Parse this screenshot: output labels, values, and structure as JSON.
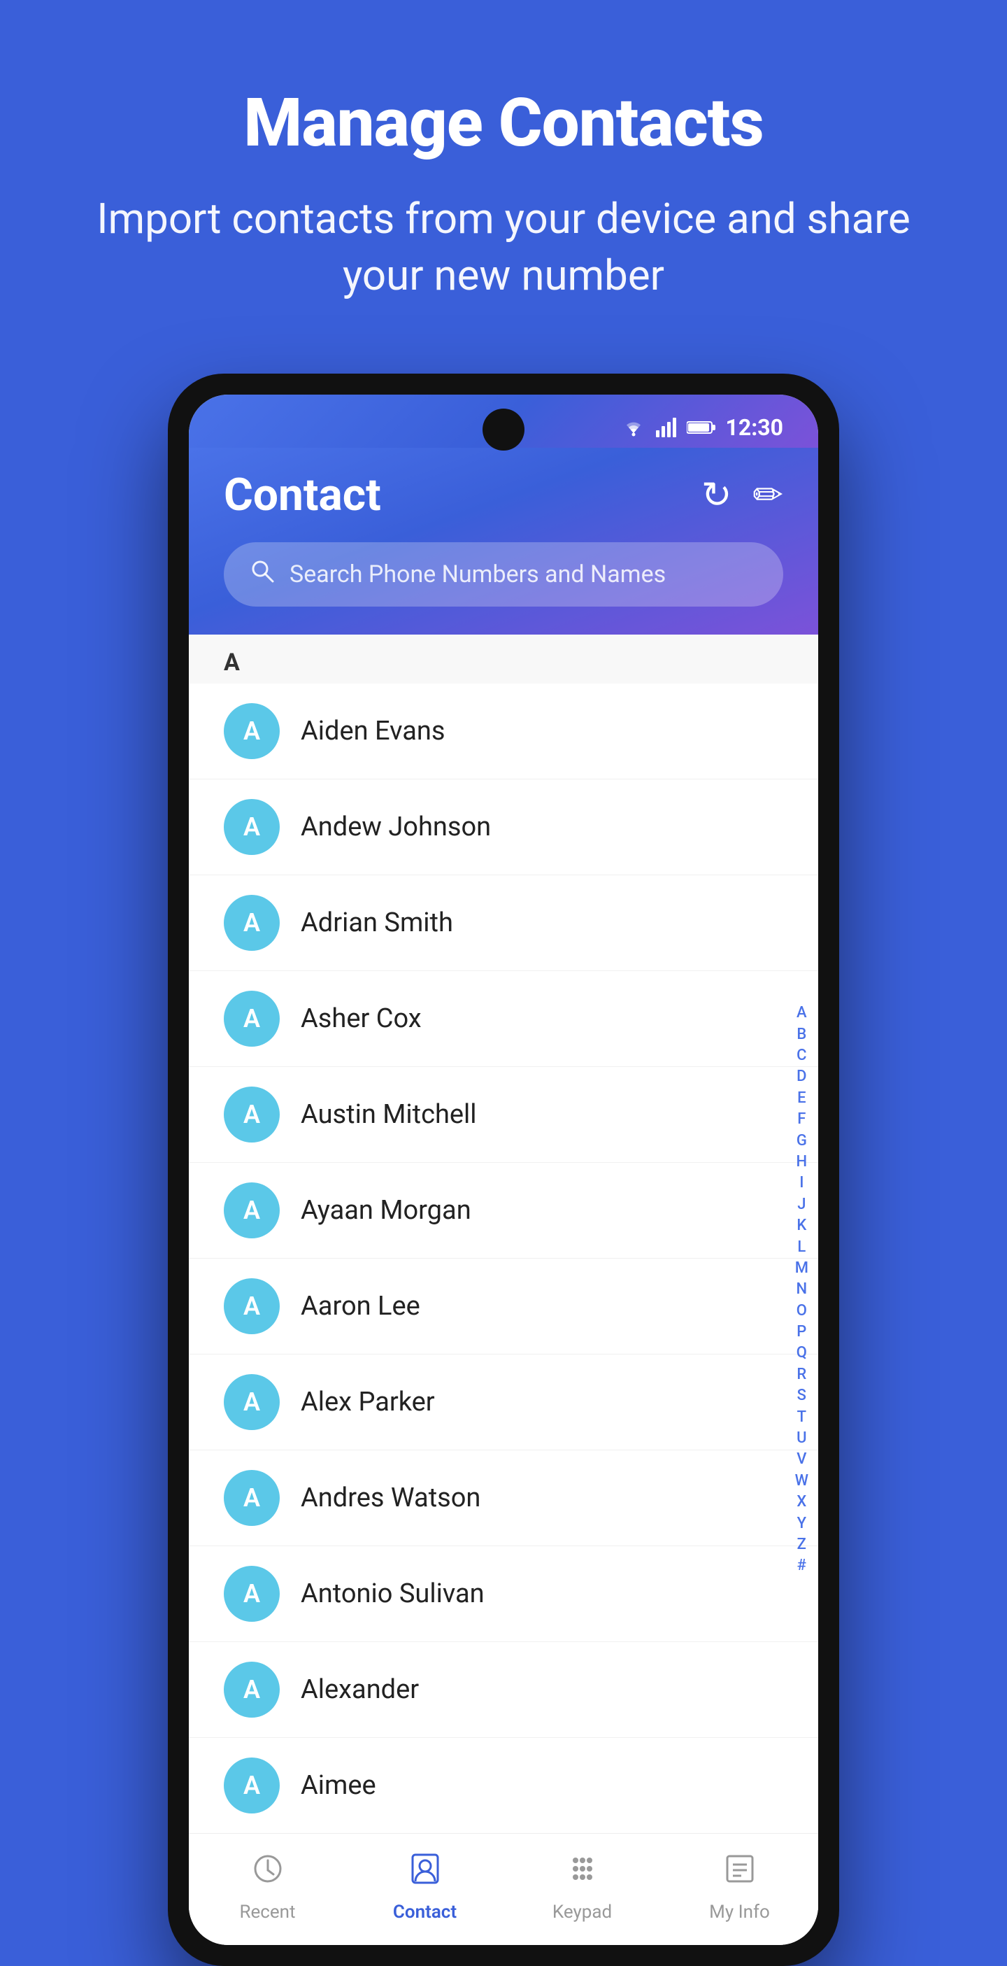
{
  "page": {
    "background_color": "#3a5fd9"
  },
  "header": {
    "title": "Manage Contacts",
    "subtitle": "Import contacts from your device and share your new number"
  },
  "status_bar": {
    "time": "12:30",
    "wifi": "▼",
    "signal": "▲",
    "battery": "🔋"
  },
  "contact_screen": {
    "title": "Contact",
    "refresh_icon": "↻",
    "edit_icon": "✏",
    "search_placeholder": "Search Phone Numbers and Names"
  },
  "contacts": [
    {
      "id": 1,
      "name": "Aiden Evans",
      "initial": "A"
    },
    {
      "id": 2,
      "name": "Andew Johnson",
      "initial": "A"
    },
    {
      "id": 3,
      "name": "Adrian Smith",
      "initial": "A"
    },
    {
      "id": 4,
      "name": "Asher Cox",
      "initial": "A"
    },
    {
      "id": 5,
      "name": "Austin Mitchell",
      "initial": "A"
    },
    {
      "id": 6,
      "name": "Ayaan Morgan",
      "initial": "A"
    },
    {
      "id": 7,
      "name": "Aaron Lee",
      "initial": "A"
    },
    {
      "id": 8,
      "name": "Alex Parker",
      "initial": "A"
    },
    {
      "id": 9,
      "name": "Andres Watson",
      "initial": "A"
    },
    {
      "id": 10,
      "name": "Antonio Sulivan",
      "initial": "A"
    },
    {
      "id": 11,
      "name": "Alexander",
      "initial": "A"
    },
    {
      "id": 12,
      "name": "Aimee",
      "initial": "A"
    }
  ],
  "section_letter": "A",
  "alphabet": [
    "A",
    "B",
    "C",
    "D",
    "E",
    "F",
    "G",
    "H",
    "I",
    "J",
    "K",
    "L",
    "M",
    "N",
    "O",
    "P",
    "Q",
    "R",
    "S",
    "T",
    "U",
    "V",
    "W",
    "X",
    "Y",
    "Z",
    "#"
  ],
  "bottom_nav": {
    "items": [
      {
        "id": "recent",
        "label": "Recent",
        "active": false
      },
      {
        "id": "contact",
        "label": "Contact",
        "active": true
      },
      {
        "id": "keypad",
        "label": "Keypad",
        "active": false
      },
      {
        "id": "myinfo",
        "label": "My Info",
        "active": false
      }
    ]
  }
}
